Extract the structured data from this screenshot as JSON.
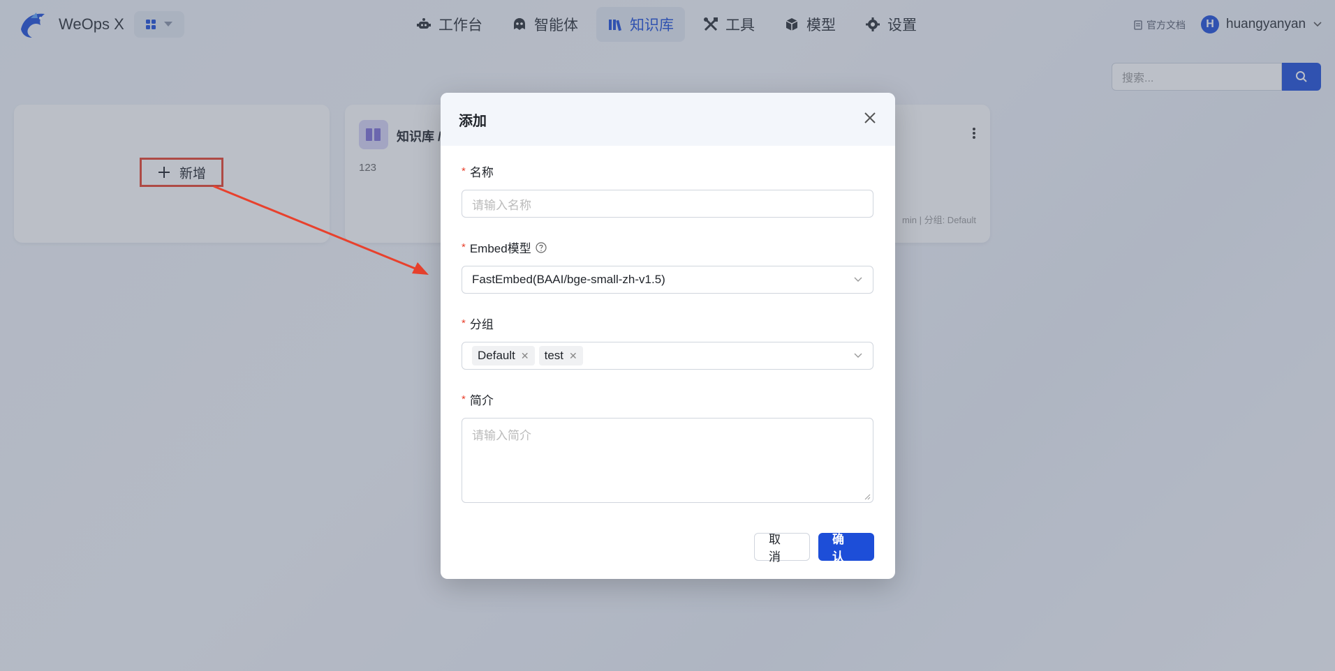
{
  "header": {
    "app_name": "WeOps X",
    "nav": [
      {
        "label": "工作台",
        "icon": "robot-icon"
      },
      {
        "label": "智能体",
        "icon": "agent-icon"
      },
      {
        "label": "知识库",
        "icon": "books-icon",
        "active": true
      },
      {
        "label": "工具",
        "icon": "tools-icon"
      },
      {
        "label": "模型",
        "icon": "cube-icon"
      },
      {
        "label": "设置",
        "icon": "gear-icon"
      }
    ],
    "doc_link": "官方文档",
    "avatar_letter": "H",
    "username": "huangyanyan"
  },
  "search": {
    "placeholder": "搜索..."
  },
  "cards": {
    "add_label": "新增",
    "kb": {
      "title": "知识库 /",
      "desc": "123",
      "meta": "min | 分组: Default"
    }
  },
  "modal": {
    "title": "添加",
    "fields": {
      "name": {
        "label": "名称",
        "placeholder": "请输入名称"
      },
      "embed": {
        "label": "Embed模型",
        "value": "FastEmbed(BAAI/bge-small-zh-v1.5)"
      },
      "group": {
        "label": "分组",
        "tags": [
          "Default",
          "test"
        ]
      },
      "intro": {
        "label": "简介",
        "placeholder": "请输入简介"
      }
    },
    "cancel_label": "取 消",
    "ok_label": "确 认"
  },
  "colors": {
    "primary": "#1d4ed8",
    "highlight": "#e8412d"
  }
}
